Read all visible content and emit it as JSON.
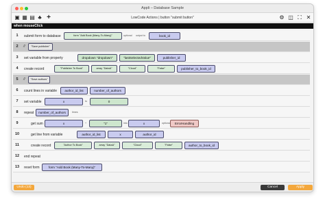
{
  "window": {
    "title": "Appli – Database Sample"
  },
  "toolbar": {
    "title": "LowCode Actions | button \"submit button\""
  },
  "event": {
    "name": "when mouseClick"
  },
  "rows": {
    "r1": {
      "num": "1",
      "text": "submit form to database",
      "form": "form \"Add Book (Many-To-Many)\"",
      "opt1": "optional",
      "opt2": "output to",
      "out": "book_id"
    },
    "r2": {
      "num": "2",
      "mark": "//",
      "comment": "\"Save publisher\""
    },
    "r3": {
      "num": "3",
      "text": "set variable from property",
      "a": "dropdown \"dropdown\"",
      "b": "\"lastSelectedValue\"",
      "c": "publisher_id"
    },
    "r4": {
      "num": "4",
      "text": "create record",
      "a": "\"Publisher To Book\"",
      "b": "array \"DataA\"",
      "c": "\"Cloud\"",
      "d": "\"False\"",
      "e": "publisher_to_book_id"
    },
    "r5": {
      "num": "5",
      "mark": "//",
      "comment": "\"Save authors\""
    },
    "r6": {
      "num": "6",
      "text": "count lines in variable",
      "a": "author_id_list",
      "b": "number_of_authors"
    },
    "r7": {
      "num": "7",
      "text": "set variable",
      "a": "x",
      "to": "to",
      "b": "0"
    },
    "r8": {
      "num": "8",
      "text": "repeat",
      "a": "number_of_authors",
      "unit": "times"
    },
    "r9": {
      "num": "9",
      "text": "get sum",
      "a": "x",
      "plus": "+",
      "b": "\"1\"",
      "into": "into",
      "c": "x",
      "opt": "optional",
      "err": "ErrorHandling"
    },
    "r10": {
      "num": "10",
      "text": "get line from variable",
      "a": "author_id_list",
      "b": "x",
      "c": "author_id"
    },
    "r11": {
      "num": "11",
      "text": "create record",
      "a": "\"Author To Book\"",
      "b": "array \"DataA\"",
      "c": "\"Cloud\"",
      "d": "\"False\"",
      "e": "author_to_book_id"
    },
    "r12": {
      "num": "12",
      "text": "end repeat"
    },
    "r13": {
      "num": "13",
      "text": "reset form",
      "a": "form \"Add Book (Many-To-Many)\""
    }
  },
  "footer": {
    "undo": "Undo (13)",
    "cancel": "Cancel",
    "apply": "Apply"
  },
  "colors": {
    "accent": "#f3a73c",
    "variable_chip": "#c9cbef",
    "text_chip": "#cde6cd",
    "error_chip": "#f0c9c6",
    "event_bar": "#111111"
  },
  "icons": [
    "layout-icon",
    "grid-icon",
    "document-icon",
    "tree-icon",
    "add-icon",
    "settings-icon",
    "panel-icon",
    "window-icon",
    "expand-icon",
    "close-icon"
  ]
}
